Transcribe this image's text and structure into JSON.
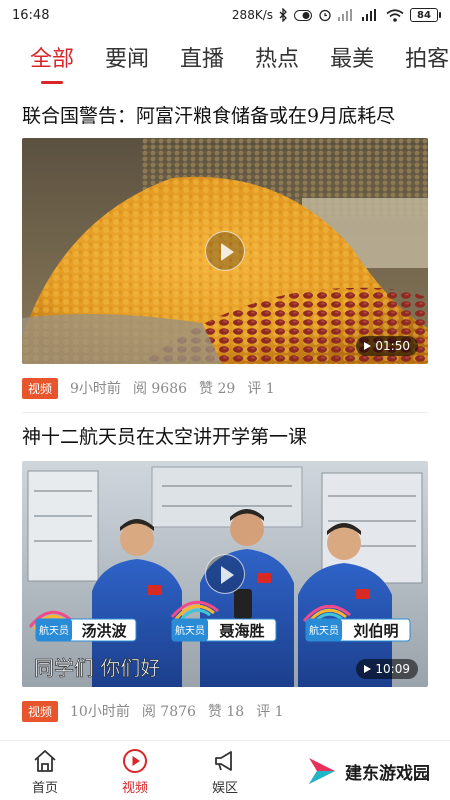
{
  "status_bar": {
    "time": "16:48",
    "network_speed": "288K/s",
    "battery": "84"
  },
  "tabs": [
    "全部",
    "要闻",
    "直播",
    "热点",
    "最美",
    "拍客"
  ],
  "feed": [
    {
      "title": "联合国警告：阿富汗粮食储备或在9月底耗尽",
      "duration": "01:50",
      "tag": "视频",
      "time": "9小时前",
      "reads_label": "阅",
      "reads": "9686",
      "likes_label": "赞",
      "likes": "29",
      "comments_label": "评",
      "comments": "1"
    },
    {
      "title": "神十二航天员在太空讲开学第一课",
      "duration": "10:09",
      "tag": "视频",
      "time": "10小时前",
      "reads_label": "阅",
      "reads": "7876",
      "likes_label": "赞",
      "likes": "18",
      "comments_label": "评",
      "comments": "1",
      "captions": {
        "name1": "汤洪波",
        "name2": "聂海胜",
        "name3": "刘伯明",
        "role": "航天员",
        "subtitle": "同学们 你们好"
      }
    }
  ],
  "bottom_nav": [
    {
      "label": "首页",
      "icon": "home-icon"
    },
    {
      "label": "视频",
      "icon": "play-circle-icon"
    },
    {
      "label": "娱区",
      "icon": "megaphone-icon"
    }
  ],
  "watermark": "建东游戏园",
  "colors": {
    "accent": "#d8262a",
    "tag": "#e8552c"
  }
}
